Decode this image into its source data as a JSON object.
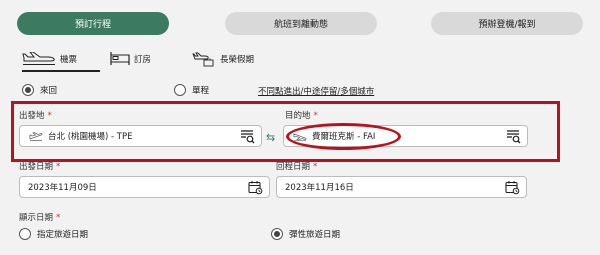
{
  "top_tabs": [
    {
      "label": "預訂行程",
      "active": true
    },
    {
      "label": "航班到離動態",
      "active": false
    },
    {
      "label": "預辦登機/報到",
      "active": false
    }
  ],
  "sub_tabs": [
    {
      "label": "機票",
      "icon": "airplane-icon"
    },
    {
      "label": "訂房",
      "icon": "bed-icon"
    },
    {
      "label": "長榮假期",
      "icon": "vacation-icon"
    }
  ],
  "trip": {
    "round_trip": "來回",
    "one_way": "單程",
    "selected": "round_trip",
    "multi_city_link": "不同點進出/中途停留/多個城市"
  },
  "origin": {
    "label": "出發地",
    "required_mark": "*",
    "value": "台北 (桃園機場) - TPE",
    "icon": "plane-takeoff-icon"
  },
  "destination": {
    "label": "目的地",
    "required_mark": "*",
    "value": "費爾班克斯 - FAI",
    "icon": "plane-landing-icon"
  },
  "swap_icon": "swap-arrows-icon",
  "departure_date": {
    "label": "出發日期",
    "required_mark": "*",
    "value": "2023年11月09日"
  },
  "return_date": {
    "label": "回程日期",
    "required_mark": "*",
    "value": "2023年11月16日"
  },
  "display_dates": {
    "label": "顯示日期",
    "required_mark": "*",
    "option_fixed": "指定旅遊日期",
    "option_flexible": "彈性旅遊日期",
    "selected": "flexible"
  },
  "colors": {
    "accent": "#3c7a62",
    "highlight": "#b8131c"
  }
}
